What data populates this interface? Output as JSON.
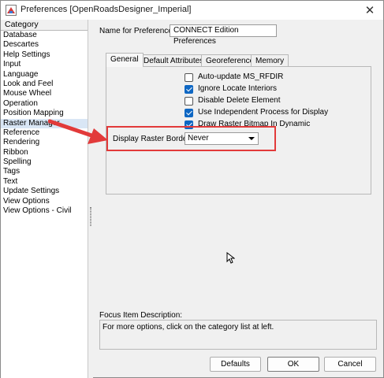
{
  "window": {
    "title": "Preferences [OpenRoadsDesigner_Imperial]",
    "close_glyph": "✕"
  },
  "category": {
    "header": "Category",
    "items": [
      {
        "label": "Database"
      },
      {
        "label": "Descartes"
      },
      {
        "label": "Help Settings"
      },
      {
        "label": "Input"
      },
      {
        "label": "Language"
      },
      {
        "label": "Look and Feel"
      },
      {
        "label": "Mouse Wheel"
      },
      {
        "label": "Operation"
      },
      {
        "label": "Position Mapping"
      },
      {
        "label": "Raster Manager",
        "selected": true
      },
      {
        "label": "Reference"
      },
      {
        "label": "Rendering"
      },
      {
        "label": "Ribbon"
      },
      {
        "label": "Spelling"
      },
      {
        "label": "Tags"
      },
      {
        "label": "Text"
      },
      {
        "label": "Update Settings"
      },
      {
        "label": "View Options"
      },
      {
        "label": "View Options - Civil"
      }
    ]
  },
  "name_field": {
    "label": "Name for Preferences:",
    "value": "CONNECT Edition Preferences"
  },
  "tabs": [
    {
      "label": "General",
      "active": true
    },
    {
      "label": "Default Attributes"
    },
    {
      "label": "Georeference"
    },
    {
      "label": "Memory"
    }
  ],
  "general": {
    "checkboxes": [
      {
        "label": "Auto-update MS_RFDIR",
        "checked": false
      },
      {
        "label": "Ignore Locate Interiors",
        "checked": true
      },
      {
        "label": "Disable Delete Element",
        "checked": false
      },
      {
        "label": "Use Independent Process for Display",
        "checked": true
      },
      {
        "label": "Draw Raster Bitmap In Dynamic",
        "checked": true
      }
    ],
    "raster_border_label": "Display Raster Border:",
    "raster_border_value": "Never"
  },
  "focus": {
    "label": "Focus Item Description:",
    "text": "For more options, click on the category list at left."
  },
  "buttons": {
    "defaults": "Defaults",
    "ok": "OK",
    "cancel": "Cancel"
  },
  "colors": {
    "annotation": "#e23a3a",
    "selection": "#d9e6f5",
    "checkbox_checked": "#0f67c3"
  }
}
